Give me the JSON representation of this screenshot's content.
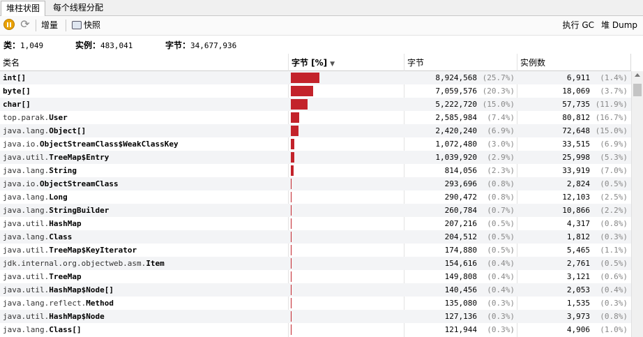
{
  "tabs": [
    {
      "label": "堆柱状图",
      "active": true
    },
    {
      "label": "每个线程分配",
      "active": false
    }
  ],
  "toolbar": {
    "delta": "增量",
    "snapshot": "快照",
    "gc": "执行 GC",
    "dump": "堆 Dump"
  },
  "summary": {
    "classes_label": "类：",
    "classes": "1,049",
    "instances_label": "实例：",
    "instances": "483,041",
    "bytes_label": "字节：",
    "bytes": "34,677,936"
  },
  "columns": {
    "name": "类名",
    "bytes_bar": "字节 [%]",
    "bytes": "字节",
    "instances": "实例数"
  },
  "rows": [
    {
      "pre": "",
      "bold": "int[]",
      "bytes": "8,924,568",
      "bytes_pct": "(25.7%)",
      "pct_value": 25.7,
      "inst": "6,911",
      "inst_pct": "(1.4%)"
    },
    {
      "pre": "",
      "bold": "byte[]",
      "bytes": "7,059,576",
      "bytes_pct": "(20.3%)",
      "pct_value": 20.3,
      "inst": "18,069",
      "inst_pct": "(3.7%)"
    },
    {
      "pre": "",
      "bold": "char[]",
      "bytes": "5,222,720",
      "bytes_pct": "(15.0%)",
      "pct_value": 15.0,
      "inst": "57,735",
      "inst_pct": "(11.9%)"
    },
    {
      "pre": "top.parak.",
      "bold": "User",
      "bytes": "2,585,984",
      "bytes_pct": "(7.4%)",
      "pct_value": 7.4,
      "inst": "80,812",
      "inst_pct": "(16.7%)"
    },
    {
      "pre": "java.lang.",
      "bold": "Object[]",
      "bytes": "2,420,240",
      "bytes_pct": "(6.9%)",
      "pct_value": 6.9,
      "inst": "72,648",
      "inst_pct": "(15.0%)"
    },
    {
      "pre": "java.io.",
      "bold": "ObjectStreamClass$WeakClassKey",
      "bytes": "1,072,480",
      "bytes_pct": "(3.0%)",
      "pct_value": 3.0,
      "inst": "33,515",
      "inst_pct": "(6.9%)"
    },
    {
      "pre": "java.util.",
      "bold": "TreeMap$Entry",
      "bytes": "1,039,920",
      "bytes_pct": "(2.9%)",
      "pct_value": 2.9,
      "inst": "25,998",
      "inst_pct": "(5.3%)"
    },
    {
      "pre": "java.lang.",
      "bold": "String",
      "bytes": "814,056",
      "bytes_pct": "(2.3%)",
      "pct_value": 2.3,
      "inst": "33,919",
      "inst_pct": "(7.0%)"
    },
    {
      "pre": "java.io.",
      "bold": "ObjectStreamClass",
      "bytes": "293,696",
      "bytes_pct": "(0.8%)",
      "pct_value": 0.8,
      "inst": "2,824",
      "inst_pct": "(0.5%)"
    },
    {
      "pre": "java.lang.",
      "bold": "Long",
      "bytes": "290,472",
      "bytes_pct": "(0.8%)",
      "pct_value": 0.8,
      "inst": "12,103",
      "inst_pct": "(2.5%)"
    },
    {
      "pre": "java.lang.",
      "bold": "StringBuilder",
      "bytes": "260,784",
      "bytes_pct": "(0.7%)",
      "pct_value": 0.7,
      "inst": "10,866",
      "inst_pct": "(2.2%)"
    },
    {
      "pre": "java.util.",
      "bold": "HashMap",
      "bytes": "207,216",
      "bytes_pct": "(0.5%)",
      "pct_value": 0.5,
      "inst": "4,317",
      "inst_pct": "(0.8%)"
    },
    {
      "pre": "java.lang.",
      "bold": "Class",
      "bytes": "204,512",
      "bytes_pct": "(0.5%)",
      "pct_value": 0.5,
      "inst": "1,812",
      "inst_pct": "(0.3%)"
    },
    {
      "pre": "java.util.",
      "bold": "TreeMap$KeyIterator",
      "bytes": "174,880",
      "bytes_pct": "(0.5%)",
      "pct_value": 0.5,
      "inst": "5,465",
      "inst_pct": "(1.1%)"
    },
    {
      "pre": "jdk.internal.org.objectweb.asm.",
      "bold": "Item",
      "bytes": "154,616",
      "bytes_pct": "(0.4%)",
      "pct_value": 0.4,
      "inst": "2,761",
      "inst_pct": "(0.5%)"
    },
    {
      "pre": "java.util.",
      "bold": "TreeMap",
      "bytes": "149,808",
      "bytes_pct": "(0.4%)",
      "pct_value": 0.4,
      "inst": "3,121",
      "inst_pct": "(0.6%)"
    },
    {
      "pre": "java.util.",
      "bold": "HashMap$Node[]",
      "bytes": "140,456",
      "bytes_pct": "(0.4%)",
      "pct_value": 0.4,
      "inst": "2,053",
      "inst_pct": "(0.4%)"
    },
    {
      "pre": "java.lang.reflect.",
      "bold": "Method",
      "bytes": "135,080",
      "bytes_pct": "(0.3%)",
      "pct_value": 0.3,
      "inst": "1,535",
      "inst_pct": "(0.3%)"
    },
    {
      "pre": "java.util.",
      "bold": "HashMap$Node",
      "bytes": "127,136",
      "bytes_pct": "(0.3%)",
      "pct_value": 0.3,
      "inst": "3,973",
      "inst_pct": "(0.8%)"
    },
    {
      "pre": "java.lang.",
      "bold": "Class[]",
      "bytes": "121,944",
      "bytes_pct": "(0.3%)",
      "pct_value": 0.3,
      "inst": "4,906",
      "inst_pct": "(1.0%)"
    }
  ],
  "colors": {
    "bar": "#c3232b",
    "alt_row": "#f3f4f6"
  }
}
